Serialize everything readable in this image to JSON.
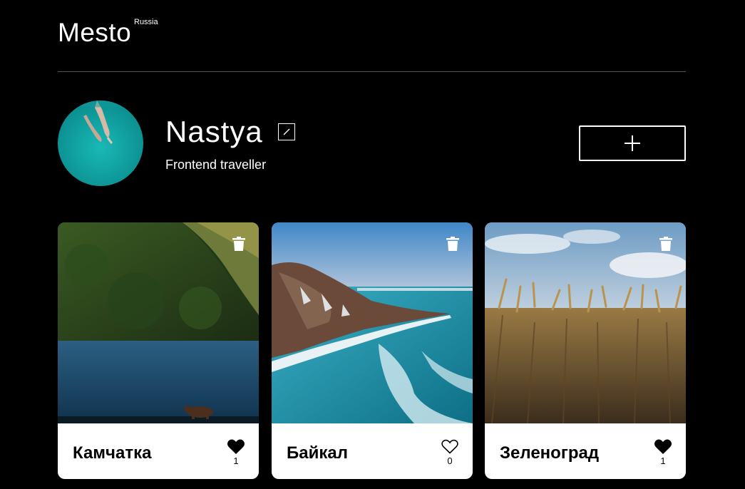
{
  "header": {
    "logo": "Mesto",
    "logo_sup": "Russia"
  },
  "profile": {
    "name": "Nastya",
    "about": "Frontend traveller",
    "edit_icon": "pencil-icon",
    "add_icon": "plus-icon"
  },
  "cards": [
    {
      "title": "Камчатка",
      "likes": "1",
      "liked": true
    },
    {
      "title": "Байкал",
      "likes": "0",
      "liked": false
    },
    {
      "title": "Зеленоград",
      "likes": "1",
      "liked": true
    }
  ],
  "colors": {
    "background": "#000000",
    "card": "#ffffff",
    "divider": "#545454"
  }
}
